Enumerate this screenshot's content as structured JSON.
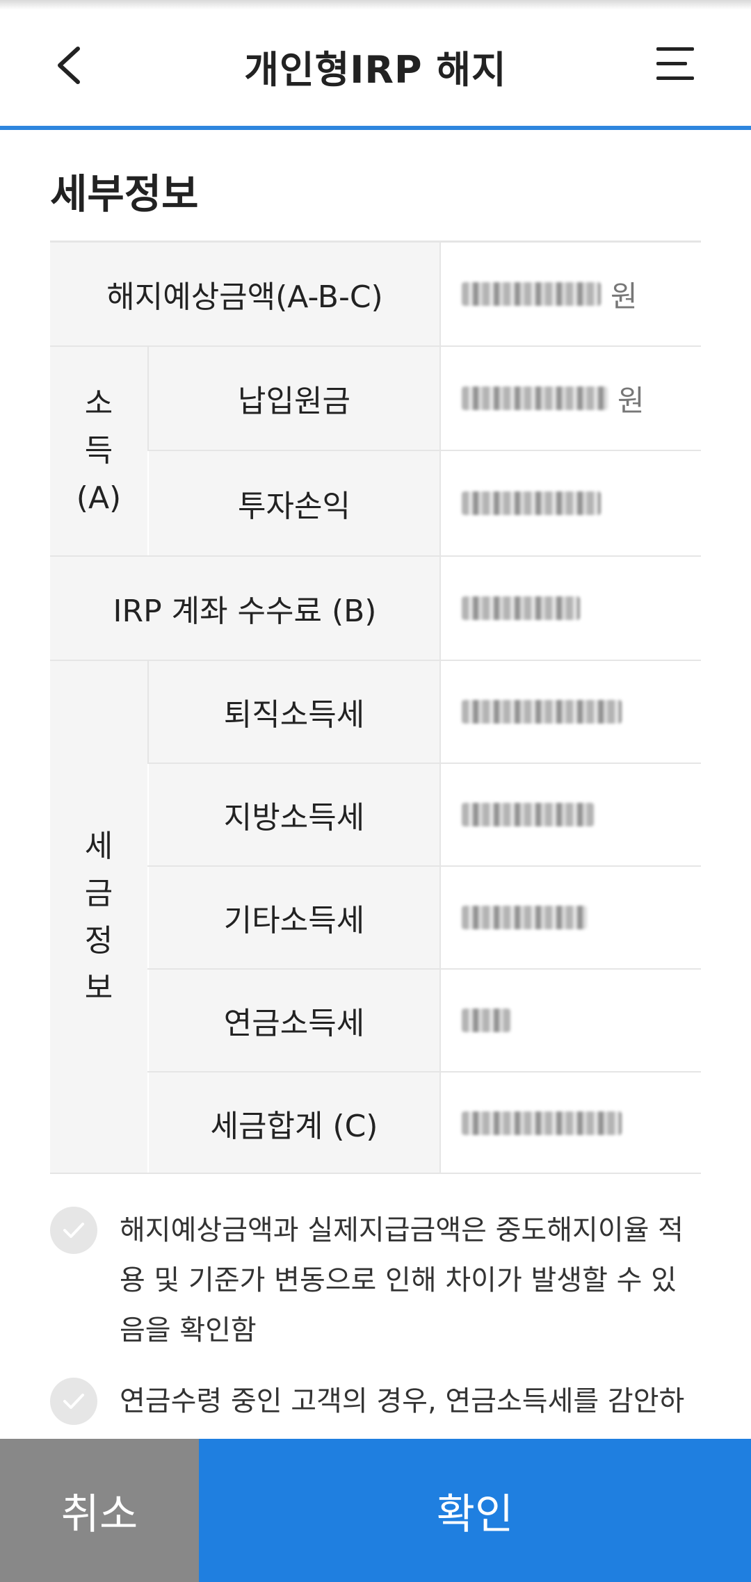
{
  "header": {
    "title": "개인형IRP 해지"
  },
  "section": {
    "title": "세부정보"
  },
  "table": {
    "rows": {
      "expected_amount": {
        "label": "해지예상금액(A-B-C)",
        "unit": "원"
      },
      "income_group": {
        "label_chars": [
          "소",
          "득",
          "(A)"
        ]
      },
      "principal": {
        "label": "납입원금",
        "unit": "원"
      },
      "investment_pnl": {
        "label": "투자손익",
        "unit": ""
      },
      "irp_fee": {
        "label": "IRP 계좌 수수료 (B)",
        "unit": ""
      },
      "tax_group": {
        "label_chars": [
          "세",
          "금",
          "정",
          "보"
        ]
      },
      "retirement_tax": {
        "label": "퇴직소득세",
        "unit": ""
      },
      "local_tax": {
        "label": "지방소득세",
        "unit": ""
      },
      "other_tax": {
        "label": "기타소득세",
        "unit": ""
      },
      "pension_tax": {
        "label": "연금소득세",
        "unit": ""
      },
      "tax_total": {
        "label": "세금합계 (C)",
        "unit": ""
      }
    }
  },
  "confirmations": [
    {
      "text": "해지예상금액과 실제지급금액은 중도해지이율 적용 및 기준가 변동으로 인해 차이가 발생할 수 있음을 확인함"
    },
    {
      "text": "연금수령 중인 고객의 경우, 연금소득세를 감안하"
    }
  ],
  "buttons": {
    "cancel": "취소",
    "confirm": "확인"
  },
  "colors": {
    "accent": "#2e86de",
    "confirm_bg": "#1f7fe0",
    "cancel_bg": "#888888",
    "label_bg": "#f5f5f5"
  }
}
